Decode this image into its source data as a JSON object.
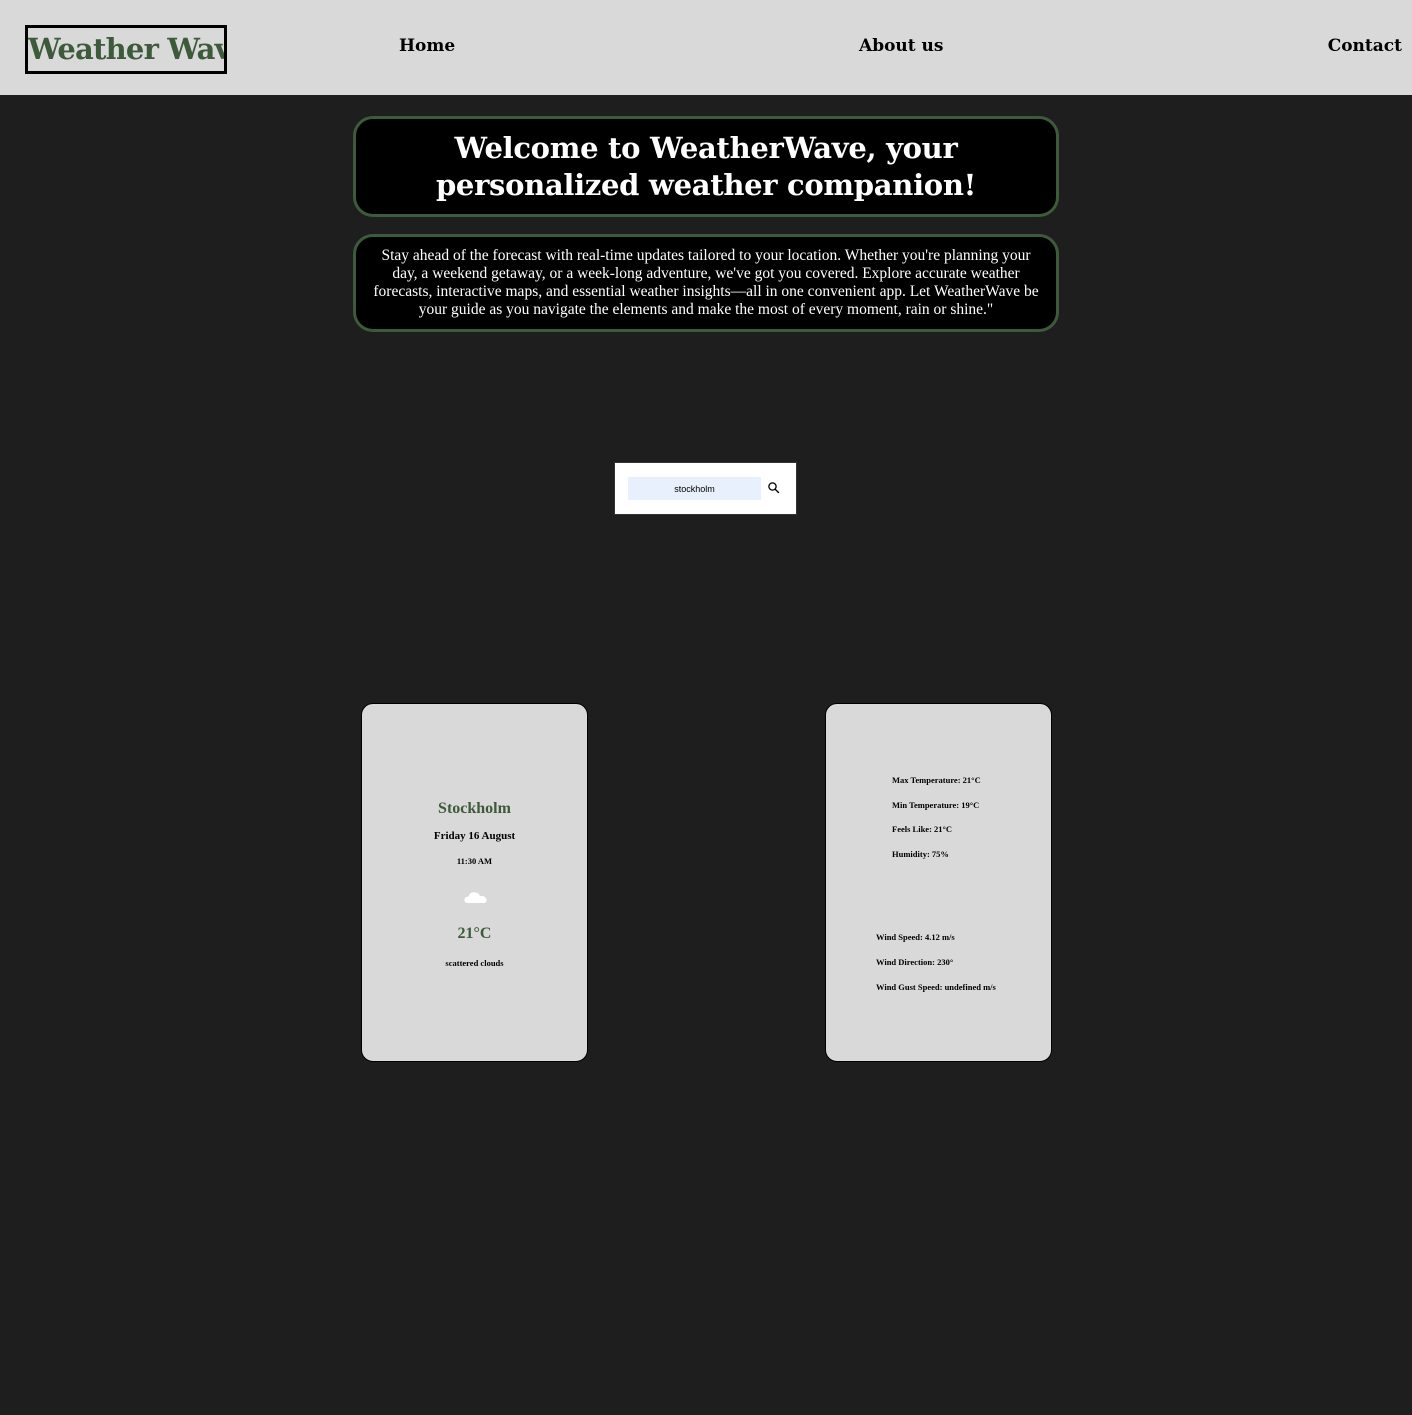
{
  "header": {
    "logo": "Weather Wave",
    "nav": {
      "home": "Home",
      "about": "About us",
      "contact": "Contact"
    }
  },
  "hero": {
    "title": "Welcome to WeatherWave, your personalized weather companion!"
  },
  "intro": {
    "text": "Stay ahead of the forecast with real-time updates tailored to your location. Whether you're planning your day, a weekend getaway, or a week-long adventure, we've got you covered. Explore accurate weather forecasts, interactive maps, and essential weather insights—all in one convenient app. Let WeatherWave be your guide as you navigate the elements and make the most of every moment, rain or shine.\""
  },
  "search": {
    "value": "stockholm",
    "icon": "search-icon"
  },
  "current": {
    "city": "Stockholm",
    "date": "Friday 16 August",
    "time": "11:30 AM",
    "icon": "cloud-icon",
    "temperature": "21°C",
    "description": "scattered clouds"
  },
  "details": {
    "max_temp": "Max Temperature: 21°C",
    "min_temp": "Min Temperature: 19°C",
    "feels_like": "Feels Like: 21°C",
    "humidity": "Humidity: 75%",
    "wind_speed": "Wind Speed: 4.12 m/s",
    "wind_direction": "Wind Direction: 230°",
    "wind_gust": "Wind Gust Speed: undefined m/s"
  },
  "colors": {
    "accent": "#3d5a3a",
    "page_background": "#1e1e1e",
    "header_background": "#d9d9d9",
    "card_background": "#d9d9d9",
    "search_input_background": "#e8f0fe"
  }
}
